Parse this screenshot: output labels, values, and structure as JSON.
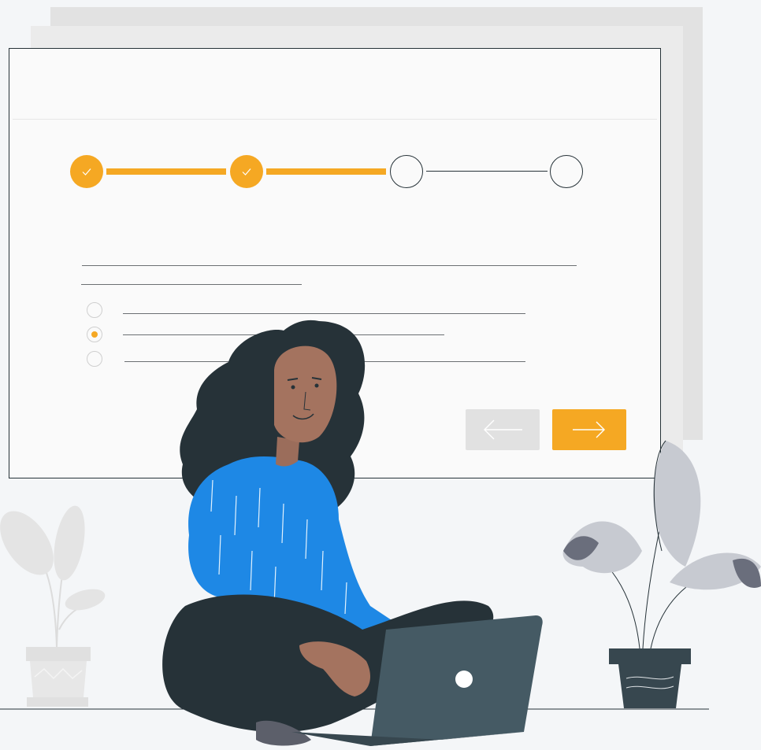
{
  "wizard": {
    "steps": [
      {
        "state": "completed",
        "icon": "checkmark-icon"
      },
      {
        "state": "completed",
        "icon": "checkmark-icon"
      },
      {
        "state": "pending"
      },
      {
        "state": "pending"
      }
    ],
    "options": [
      {
        "selected": false
      },
      {
        "selected": true
      },
      {
        "selected": false
      }
    ],
    "buttons": {
      "back": {
        "icon": "arrow-left-icon"
      },
      "next": {
        "icon": "arrow-right-icon"
      }
    }
  },
  "colors": {
    "accent": "#f5a823",
    "outline": "#263238",
    "disabled_button": "#e1e1e1",
    "sweater": "#1e88e5",
    "laptop": "#455a64"
  },
  "illustration": {
    "subject": "woman-sitting-with-laptop",
    "plants": [
      "plant-left-icon",
      "plant-right-icon"
    ]
  }
}
